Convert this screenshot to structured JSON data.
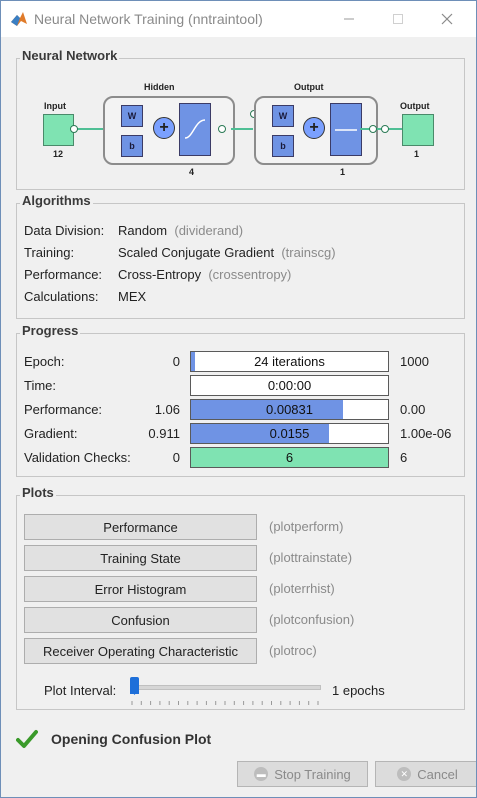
{
  "window": {
    "title": "Neural Network Training (nntraintool)"
  },
  "network": {
    "panel_title": "Neural Network",
    "input_label": "Input",
    "input_size": "12",
    "hidden_label": "Hidden",
    "hidden_size": "4",
    "output_layer_label": "Output",
    "output_layer_size": "1",
    "output_label": "Output",
    "output_size": "1",
    "weight_glyph": "W",
    "bias_glyph": "b",
    "sum_glyph": "+"
  },
  "algorithms": {
    "panel_title": "Algorithms",
    "rows": [
      {
        "label": "Data Division:",
        "value": "Random",
        "fn": "(dividerand)"
      },
      {
        "label": "Training:",
        "value": "Scaled Conjugate Gradient",
        "fn": "(trainscg)"
      },
      {
        "label": "Performance:",
        "value": "Cross-Entropy",
        "fn": "(crossentropy)"
      },
      {
        "label": "Calculations:",
        "value": "MEX",
        "fn": ""
      }
    ]
  },
  "progress": {
    "panel_title": "Progress",
    "rows": [
      {
        "label": "Epoch:",
        "min": "0",
        "text": "24 iterations",
        "max": "1000",
        "fill": 0.02,
        "color": "#6f93e4"
      },
      {
        "label": "Time:",
        "min": "",
        "text": "0:00:00",
        "max": "",
        "fill": 0.0,
        "color": "#6f93e4"
      },
      {
        "label": "Performance:",
        "min": "1.06",
        "text": "0.00831",
        "max": "0.00",
        "fill": 0.77,
        "color": "#6f93e4"
      },
      {
        "label": "Gradient:",
        "min": "0.911",
        "text": "0.0155",
        "max": "1.00e-06",
        "fill": 0.7,
        "color": "#6f93e4"
      },
      {
        "label": "Validation Checks:",
        "min": "0",
        "text": "6",
        "max": "6",
        "fill": 1.0,
        "color": "#7fe3b2"
      }
    ]
  },
  "plots": {
    "panel_title": "Plots",
    "buttons": [
      {
        "label": "Performance",
        "fn": "(plotperform)"
      },
      {
        "label": "Training State",
        "fn": "(plottrainstate)"
      },
      {
        "label": "Error Histogram",
        "fn": "(ploterrhist)"
      },
      {
        "label": "Confusion",
        "fn": "(plotconfusion)"
      },
      {
        "label": "Receiver Operating Characteristic",
        "fn": "(plotroc)"
      }
    ],
    "interval_label": "Plot Interval:",
    "interval_value": "1 epochs"
  },
  "status": {
    "text": "Opening Confusion Plot"
  },
  "footer": {
    "stop_label": "Stop Training",
    "cancel_label": "Cancel"
  }
}
